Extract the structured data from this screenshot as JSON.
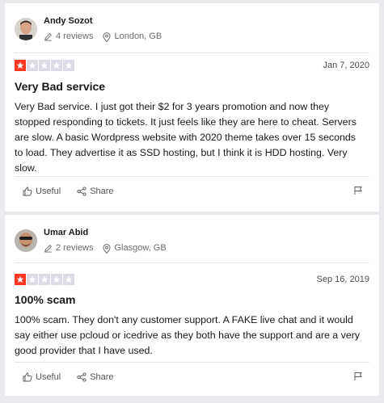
{
  "reviews": [
    {
      "reviewer": {
        "name": "Andy Sozot",
        "review_count": "4 reviews",
        "location": "London, GB"
      },
      "rating": 1,
      "rating_max": 5,
      "date": "Jan 7, 2020",
      "title": "Very Bad service",
      "body": "Very Bad service. I just got their $2 for 3 years promotion and now they stopped responding to tickets. It just feels like they are here to cheat. Servers are slow. A basic Wordpress website with 2020 theme takes over 15 seconds to load. They advertise it as SSD hosting, but I think it is HDD hosting. Very slow.",
      "actions": {
        "useful_label": "Useful",
        "share_label": "Share"
      }
    },
    {
      "reviewer": {
        "name": "Umar Abid",
        "review_count": "2 reviews",
        "location": "Glasgow, GB"
      },
      "rating": 1,
      "rating_max": 5,
      "date": "Sep 16, 2019",
      "title": "100% scam",
      "body": "100% scam. They don't any customer support. A FAKE live chat and it would say either use pcloud or icedrive as they both have the support and are a very good provider that I have used.",
      "actions": {
        "useful_label": "Useful",
        "share_label": "Share"
      }
    }
  ],
  "colors": {
    "star_filled_bg": "#ff3722",
    "star_empty_bg": "#dcdce6",
    "star_glyph": "#ffffff"
  },
  "icons": [
    "pencil-icon",
    "location-pin-icon",
    "star-icon",
    "thumbs-up-icon",
    "share-icon",
    "flag-icon"
  ]
}
